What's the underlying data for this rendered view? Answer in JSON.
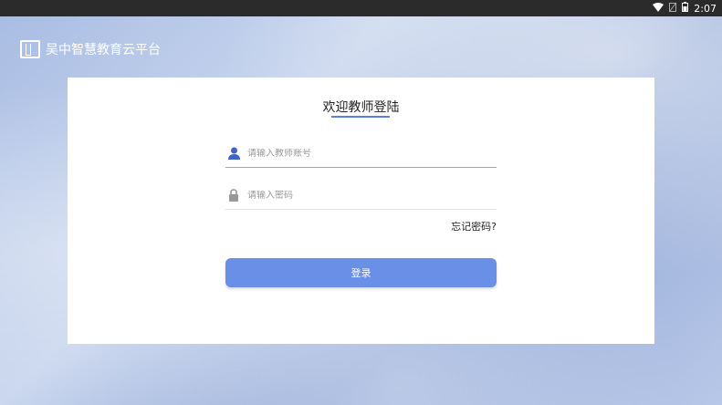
{
  "status_bar": {
    "time": "2:07"
  },
  "brand": {
    "name": "吴中智慧教育云平台"
  },
  "login": {
    "title": "欢迎教师登陆",
    "account_placeholder": "请输入教师账号",
    "password_placeholder": "请输入密码",
    "forgot_label": "忘记密码?",
    "submit_label": "登录"
  },
  "icons": {
    "account": "user-icon",
    "password": "lock-icon",
    "logo": "book-logo-icon",
    "wifi": "wifi-icon",
    "battery": "battery-icon"
  },
  "colors": {
    "accent": "#6a8fe6",
    "underline": "#5b7ee0",
    "status_bar": "#2b2b2b"
  }
}
